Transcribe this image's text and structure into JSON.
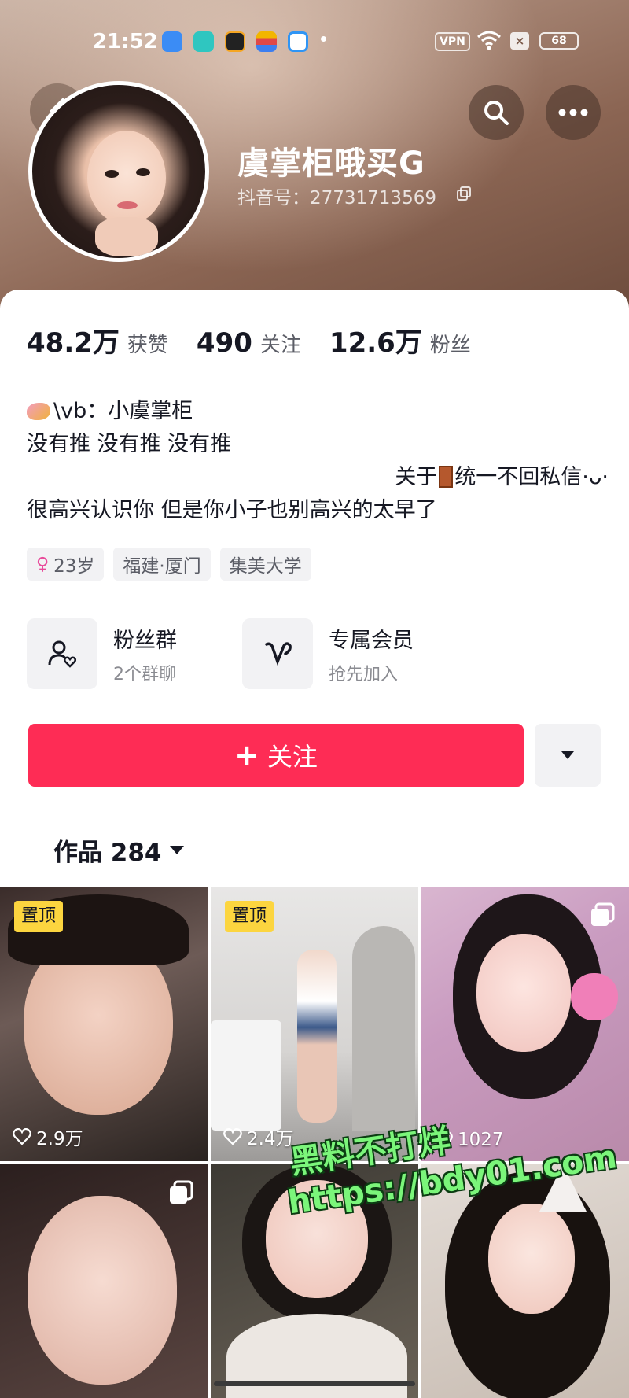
{
  "status_bar": {
    "time": "21:52",
    "vpn_label": "VPN",
    "sim_label": "×",
    "battery": "68",
    "app_colors": [
      "#3b8cf5",
      "#2fc6c0",
      "#222222",
      "#f2b600",
      "#2f95f5"
    ]
  },
  "header": {
    "back_icon": "chevron-left-icon",
    "search_icon": "search-icon",
    "more_icon": "more-horizontal-icon",
    "name": "虞掌柜哦买G",
    "douyin_id": "抖音号：27731713569"
  },
  "stats": [
    {
      "value": "48.2万",
      "label": "获赞"
    },
    {
      "value": "490",
      "label": "关注"
    },
    {
      "value": "12.6万",
      "label": "粉丝"
    }
  ],
  "bio": {
    "line1": "\\vb：小虞掌柜",
    "line2": "没有推 没有推 没有推",
    "line3a": "关于",
    "line3b": "统一不回私信·ᴗ·",
    "line4": "很高兴认识你 但是你小子也别高兴的太早了"
  },
  "tags": {
    "age": "23岁",
    "location": "福建·厦门",
    "school": "集美大学"
  },
  "entries": {
    "fans_group_title": "粉丝群",
    "fans_group_sub": "2个群聊",
    "member_title": "专属会员",
    "member_sub": "抢先加入"
  },
  "actions": {
    "follow_label": "关注",
    "follow_plus": "+"
  },
  "works": {
    "tab_label": "作品 284"
  },
  "grid": {
    "pin_label": "置顶",
    "likes": [
      "2.9万",
      "2.4万",
      "1027"
    ]
  },
  "watermark": {
    "line1": "黑料不打烊",
    "line2": "https://bdy01.com"
  },
  "colors": {
    "accent": "#fe2c55",
    "pin": "#fcd53f",
    "watermark": "#7bf57a"
  }
}
